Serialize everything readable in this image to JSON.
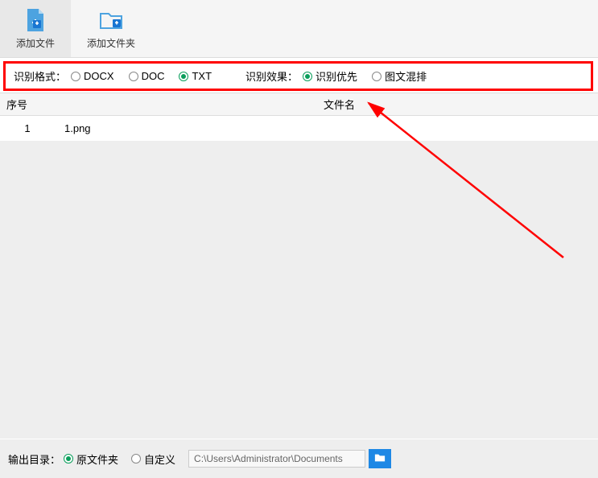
{
  "toolbar": {
    "add_file": "添加文件",
    "add_folder": "添加文件夹"
  },
  "options": {
    "format_label": "识别格式：",
    "formats": [
      "DOCX",
      "DOC",
      "TXT"
    ],
    "format_selected": "TXT",
    "effect_label": "识别效果：",
    "effects": [
      "识别优先",
      "图文混排"
    ],
    "effect_selected": "识别优先"
  },
  "table": {
    "col_no": "序号",
    "col_name": "文件名",
    "rows": [
      {
        "no": "1",
        "name": "1.png"
      }
    ]
  },
  "footer": {
    "output_label": "输出目录：",
    "options": [
      "原文件夹",
      "自定义"
    ],
    "selected": "原文件夹",
    "path": "C:\\Users\\Administrator\\Documents"
  }
}
